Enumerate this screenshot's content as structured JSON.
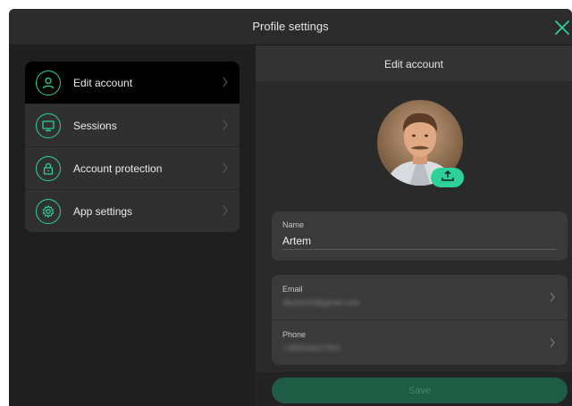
{
  "window": {
    "title": "Profile settings",
    "close_icon": "close-icon",
    "accent": "#2fd19a"
  },
  "menu": {
    "items": [
      {
        "label": "Edit account",
        "icon": "user-icon",
        "active": true
      },
      {
        "label": "Sessions",
        "icon": "monitor-icon",
        "active": false
      },
      {
        "label": "Account protection",
        "icon": "lock-icon",
        "active": false
      },
      {
        "label": "App settings",
        "icon": "gear-icon",
        "active": false
      }
    ]
  },
  "edit_account": {
    "title": "Edit account",
    "avatar_icon": "avatar",
    "upload_icon": "upload-icon",
    "name": {
      "label": "Name",
      "value": "Artem"
    },
    "email": {
      "label": "Email",
      "value": "dkyrke22@gmail.com"
    },
    "phone": {
      "label": "Phone",
      "value": "+380634427801"
    },
    "save_label": "Save"
  }
}
